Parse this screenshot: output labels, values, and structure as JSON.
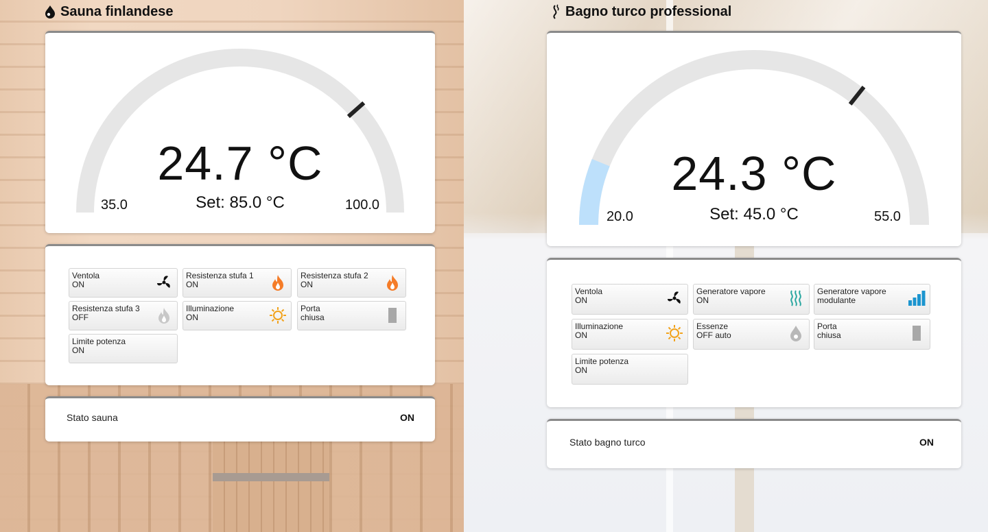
{
  "sauna": {
    "title": "Sauna finlandese",
    "temperature": "24.7 °C",
    "setpoint": "Set: 85.0 °C",
    "min": "35.0",
    "max": "100.0",
    "setpoint_fraction": 0.769,
    "current_fraction": 0.0,
    "controls": [
      {
        "name": "Ventola",
        "state": "ON",
        "icon": "fan-icon"
      },
      {
        "name": "Resistenza stufa 1",
        "state": "ON",
        "icon": "flame-icon"
      },
      {
        "name": "Resistenza stufa 2",
        "state": "ON",
        "icon": "flame-icon"
      },
      {
        "name": "Resistenza stufa 3",
        "state": "OFF",
        "icon": "flame-off-icon"
      },
      {
        "name": "Illuminazione",
        "state": "ON",
        "icon": "sun-icon"
      },
      {
        "name": "Porta",
        "state": "chiusa",
        "icon": "door-icon"
      },
      {
        "name": "Limite potenza",
        "state": "ON",
        "icon": ""
      }
    ],
    "status_label": "Stato sauna",
    "status_value": "ON"
  },
  "turco": {
    "title": "Bagno turco professional",
    "temperature": "24.3 °C",
    "setpoint": "Set: 45.0 °C",
    "min": "20.0",
    "max": "55.0",
    "setpoint_fraction": 0.714,
    "current_fraction": 0.123,
    "controls": [
      {
        "name": "Ventola",
        "state": "ON",
        "icon": "fan-icon"
      },
      {
        "name": "Generatore vapore",
        "state": "ON",
        "icon": "steam-icon"
      },
      {
        "name": "Generatore vapore",
        "state": "modulante",
        "icon": "signal-bars-icon"
      },
      {
        "name": "Illuminazione",
        "state": "ON",
        "icon": "sun-icon"
      },
      {
        "name": "Essenze",
        "state": "OFF auto",
        "icon": "drop-icon"
      },
      {
        "name": "Porta",
        "state": "chiusa",
        "icon": "door-icon"
      },
      {
        "name": "Limite potenza",
        "state": "ON",
        "icon": ""
      }
    ],
    "status_label": "Stato bagno turco",
    "status_value": "ON"
  },
  "colors": {
    "gauge_track": "#e6e6e6",
    "gauge_fill": "#bde0fb",
    "flame": "#f57c28",
    "flame_off": "#c8c8c8",
    "sun": "#f2a21a",
    "steam": "#2aa7a0",
    "bars": "#1c95cf",
    "door": "#a8a8a8"
  }
}
